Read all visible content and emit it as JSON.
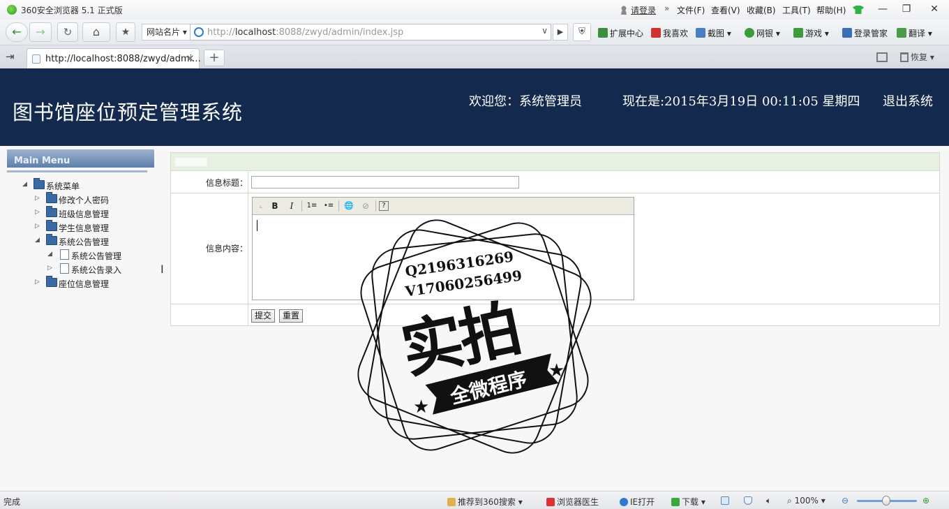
{
  "browser": {
    "app_title": "360安全浏览器 5.1 正式版",
    "login_link": "请登录",
    "menu_sep": "»",
    "menus": [
      "文件(F)",
      "查看(V)",
      "收藏(B)",
      "工具(T)",
      "帮助(H)"
    ],
    "window_buttons": [
      "—",
      "❐",
      "✕"
    ],
    "site_card": "网站名片 ▾",
    "address_prefix": "http://",
    "address_host": "localhost",
    "address_rest": ":8088/zwyd/admin/index.jsp",
    "toolbar_items": [
      "扩展中心",
      "我喜欢",
      "截图",
      "网银",
      "游戏",
      "登录管家",
      "翻译"
    ],
    "tab_title": "http://localhost:8088/zwyd/admi...",
    "restore_label": "恢复",
    "status_text": "完成",
    "status_items": [
      "推荐到360搜索",
      "浏览器医生",
      "IE打开",
      "下载",
      "100%"
    ]
  },
  "header": {
    "title": "图书馆座位预定管理系统",
    "welcome": "欢迎您：系统管理员",
    "datetime": "现在是:2015年3月19日  00:11:05 星期四",
    "logout": "退出系统"
  },
  "menu": {
    "header": "Main Menu",
    "tree": [
      {
        "label": "系统菜单",
        "type": "folder",
        "expanded": true,
        "level": 0
      },
      {
        "label": "修改个人密码",
        "type": "folder",
        "expanded": false,
        "level": 1
      },
      {
        "label": "班级信息管理",
        "type": "folder",
        "expanded": false,
        "level": 1
      },
      {
        "label": "学生信息管理",
        "type": "folder",
        "expanded": false,
        "level": 1
      },
      {
        "label": "系统公告管理",
        "type": "folder",
        "expanded": true,
        "level": 1
      },
      {
        "label": "系统公告管理",
        "type": "page",
        "expanded": true,
        "level": 2
      },
      {
        "label": "系统公告录入",
        "type": "page",
        "expanded": false,
        "level": 2
      },
      {
        "label": "座位信息管理",
        "type": "folder",
        "expanded": false,
        "level": 1
      }
    ]
  },
  "form": {
    "title_label": "信息标题：",
    "title_value": "",
    "content_label": "信息内容：",
    "editor_buttons": [
      "B",
      "I",
      "1≡",
      "•≡",
      "🌐",
      "⊘",
      "?"
    ],
    "submit": "提交",
    "reset": "重置"
  },
  "watermark": {
    "qq": "Q2196316269",
    "wx": "V17060256499",
    "main": "实拍",
    "sub": "全微程序"
  }
}
